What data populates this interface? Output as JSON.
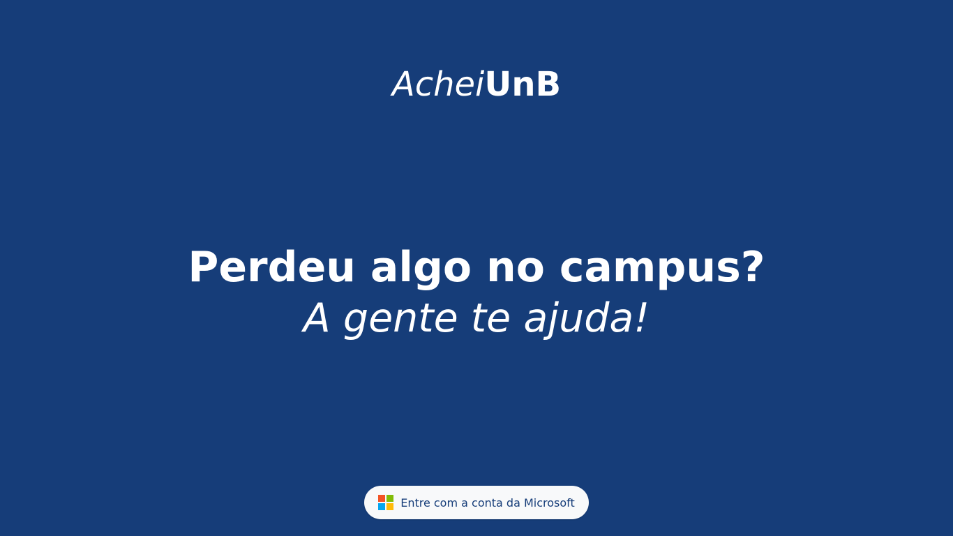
{
  "brand": {
    "italic_part": "Achei",
    "bold_part": "UnB"
  },
  "hero": {
    "headline": "Perdeu algo no campus?",
    "subheadline": "A gente te ajuda!"
  },
  "login": {
    "label": "Entre com a conta da Microsoft",
    "icon": "microsoft-logo-icon"
  },
  "colors": {
    "background": "#163d79",
    "text": "#ffffff",
    "button_background": "#f8f9fa",
    "button_text": "#163d79",
    "microsoft_red": "#f35325",
    "microsoft_green": "#81bc06",
    "microsoft_blue": "#05a6f0",
    "microsoft_yellow": "#ffba08"
  }
}
